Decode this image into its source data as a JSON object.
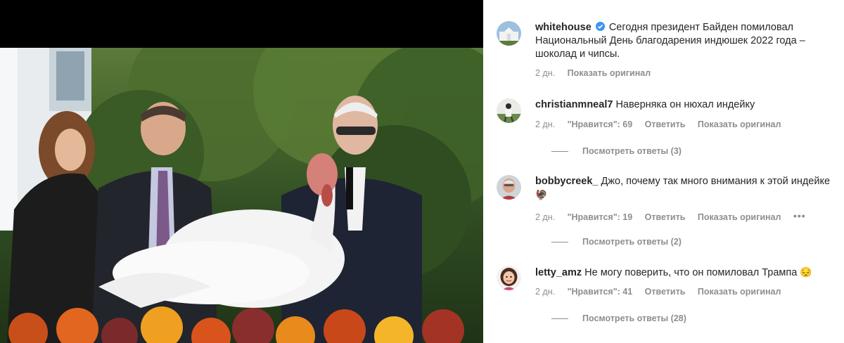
{
  "post": {
    "author": "whitehouse",
    "verified": true,
    "caption": "Сегодня президент Байден помиловал Национальный День благодарения индюшек 2022 года – шоколад и чипсы.",
    "time": "2 дн.",
    "show_original": "Показать оригинал",
    "avatar_icon": "white-house-icon"
  },
  "comments": [
    {
      "username": "christianmneal7",
      "text": "Наверняка он нюхал индейку",
      "time": "2 дн.",
      "likes": "\"Нравится\": 69",
      "reply": "Ответить",
      "show_original": "Показать оригинал",
      "view_replies": "Посмотреть ответы (3)",
      "avatar_icon": "baseball-player-icon"
    },
    {
      "username": "bobbycreek_",
      "text": "Джо, почему так много внимания к этой индейке",
      "emoji": "🦃",
      "time": "2 дн.",
      "likes": "\"Нравится\": 19",
      "reply": "Ответить",
      "show_original": "Показать оригинал",
      "more": "•••",
      "view_replies": "Посмотреть ответы (2)",
      "avatar_icon": "man-portrait-icon"
    },
    {
      "username": "letty_amz",
      "text": "Не могу поверить, что он помиловал Трампа",
      "emoji": "😔",
      "time": "2 дн.",
      "likes": "\"Нравится\": 41",
      "reply": "Ответить",
      "show_original": "Показать оригинал",
      "view_replies": "Посмотреть ответы (28)",
      "avatar_icon": "cartoon-woman-icon"
    }
  ],
  "colors": {
    "verified": "#3897f0",
    "muted": "#8e8e8e",
    "text": "#262626"
  }
}
